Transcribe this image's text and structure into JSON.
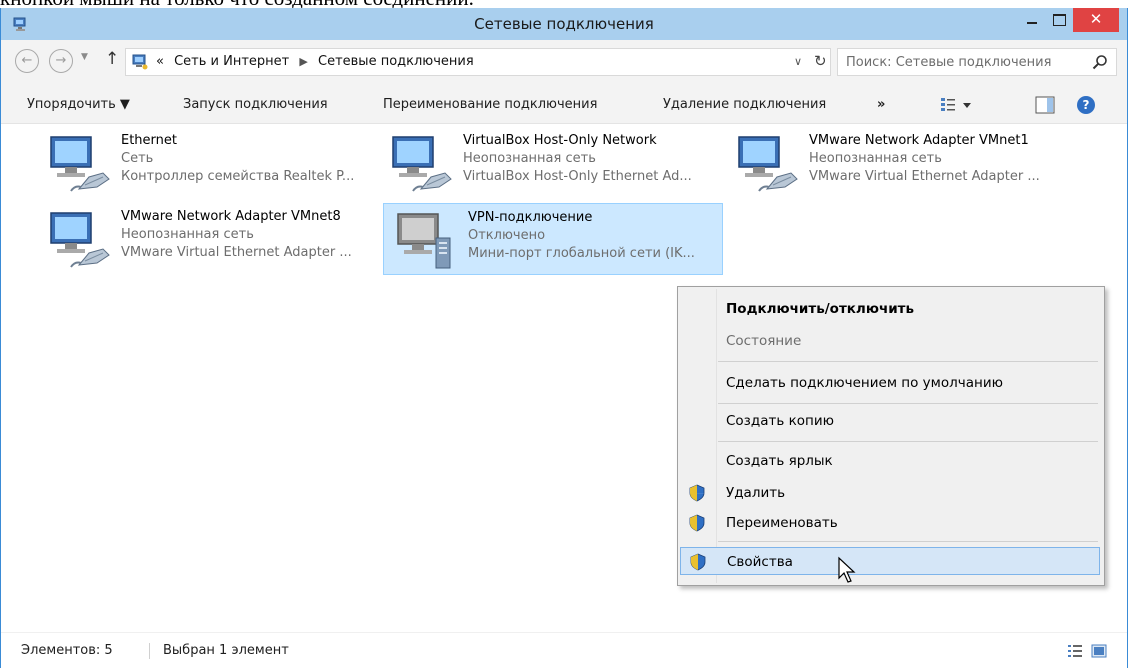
{
  "document": {
    "above_text": "кнопкой мыши на только что созданном соединении."
  },
  "window": {
    "title": "Сетевые подключения",
    "minimize_label": "–",
    "close_label": "✕"
  },
  "address": {
    "overflow": "«",
    "path": [
      "Сеть и Интернет",
      "Сетевые подключения"
    ],
    "search_placeholder": "Поиск: Сетевые подключения"
  },
  "toolbar": {
    "organize": "Упорядочить ▼",
    "start": "Запуск подключения",
    "rename": "Переименование подключения",
    "delete": "Удаление подключения",
    "more": "»"
  },
  "connections": [
    {
      "name": "Ethernet",
      "status": "Сеть",
      "device": "Контроллер семейства Realtek P..."
    },
    {
      "name": "VirtualBox Host-Only Network",
      "status": "Неопознанная сеть",
      "device": "VirtualBox Host-Only Ethernet Ad..."
    },
    {
      "name": "VMware Network Adapter VMnet1",
      "status": "Неопознанная сеть",
      "device": "VMware Virtual Ethernet Adapter ..."
    },
    {
      "name": "VMware Network Adapter VMnet8",
      "status": "Неопознанная сеть",
      "device": "VMware Virtual Ethernet Adapter ..."
    },
    {
      "name": "VPN-подключение",
      "status": "Отключено",
      "device": "Мини-порт глобальной сети (IK..."
    }
  ],
  "context_menu": {
    "items": [
      {
        "label": "Подключить/отключить"
      },
      {
        "label": "Состояние"
      },
      {
        "label": "Сделать подключением по умолчанию"
      },
      {
        "label": "Создать копию"
      },
      {
        "label": "Создать ярлык"
      },
      {
        "label": "Удалить"
      },
      {
        "label": "Переименовать"
      },
      {
        "label": "Свойства"
      }
    ]
  },
  "statusbar": {
    "count": "Элементов: 5",
    "selected": "Выбран 1 элемент"
  },
  "colors": {
    "titlebar": "#a9cfee",
    "close": "#e04343",
    "selection": "#cce8ff",
    "menu_hover": "#d5e6f7"
  }
}
